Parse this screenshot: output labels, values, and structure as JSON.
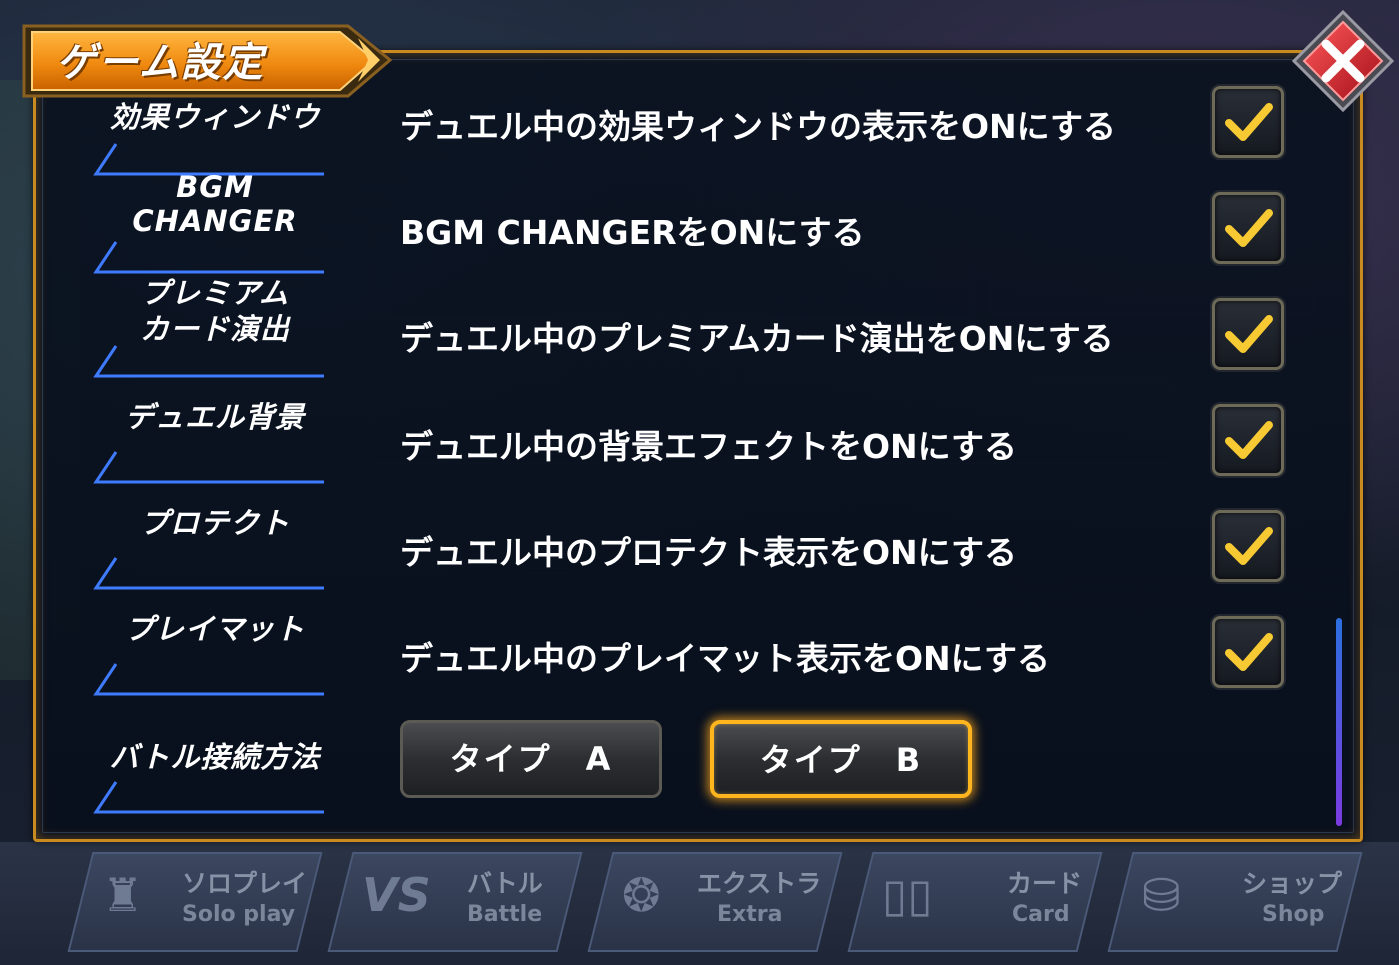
{
  "dialog": {
    "title": "ゲーム設定",
    "close_icon": "close-icon"
  },
  "settings": [
    {
      "label_lines": [
        "効果ウィンドウ"
      ],
      "description": "デュエル中の効果ウィンドウの表示をONにする",
      "checked": true
    },
    {
      "label_lines": [
        "BGM",
        "CHANGER"
      ],
      "description": "BGM CHANGERをONにする",
      "checked": true
    },
    {
      "label_lines": [
        "プレミアム",
        "カード演出"
      ],
      "description": "デュエル中のプレミアムカード演出をONにする",
      "checked": true
    },
    {
      "label_lines": [
        "デュエル背景"
      ],
      "description": "デュエル中の背景エフェクトをONにする",
      "checked": true
    },
    {
      "label_lines": [
        "プロテクト"
      ],
      "description": "デュエル中のプロテクト表示をONにする",
      "checked": true
    },
    {
      "label_lines": [
        "プレイマット"
      ],
      "description": "デュエル中のプレイマット表示をONにする",
      "checked": true
    }
  ],
  "battle_connection": {
    "label": "バトル接続方法",
    "option_a": "タイプ　A",
    "option_b": "タイプ　B",
    "selected": "B"
  },
  "bottom_nav": [
    {
      "jp": "ソロプレイ",
      "en": "Solo play"
    },
    {
      "jp": "バトル",
      "en": "Battle"
    },
    {
      "jp": "エクストラ",
      "en": "Extra"
    },
    {
      "jp": "カード",
      "en": "Card"
    },
    {
      "jp": "ショップ",
      "en": "Shop"
    }
  ],
  "colors": {
    "accent_orange": "#f5a21e",
    "check_yellow": "#f7c933",
    "close_red": "#d0202a",
    "label_line_blue": "#3f7bff"
  }
}
